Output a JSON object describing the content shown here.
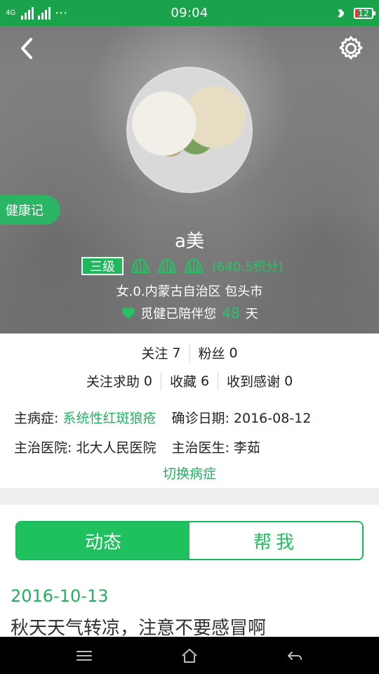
{
  "status_bar": {
    "time": "09:04",
    "battery": "12",
    "network": "4G",
    "bluetooth_icon": "bluetooth-icon"
  },
  "header": {
    "back_icon": "chevron-left-icon",
    "settings_icon": "gear-icon",
    "health_tag": "健康记",
    "username": "a美",
    "level": "三级",
    "points": "(640.5积分)",
    "location": "女.0.内蒙古自治区 包头市",
    "companion_prefix": "觅健已陪伴您",
    "companion_days": "48",
    "companion_suffix": "天"
  },
  "stats": {
    "row1": [
      {
        "label": "关注",
        "value": "7"
      },
      {
        "label": "粉丝",
        "value": "0"
      }
    ],
    "row2": [
      {
        "label": "关注求助",
        "value": "0"
      },
      {
        "label": "收藏",
        "value": "6"
      },
      {
        "label": "收到感谢",
        "value": "0"
      }
    ]
  },
  "details": {
    "disease_label": "主病症:",
    "disease_value": "系统性红斑狼疮",
    "diagnosis_label": "确诊日期:",
    "diagnosis_value": "2016-08-12",
    "hospital_label": "主治医院:",
    "hospital_value": "北大人民医院",
    "doctor_label": "主治医生:",
    "doctor_value": "李茹",
    "switch_label": "切换病症"
  },
  "tabs": {
    "active_label": "动态",
    "inactive_label": "帮我"
  },
  "post": {
    "date": "2016-10-13",
    "text": "秋天天气转凉，注意不要感冒啊"
  },
  "colors": {
    "brand_green": "#1ec15e",
    "status_green": "#1aa34a"
  }
}
